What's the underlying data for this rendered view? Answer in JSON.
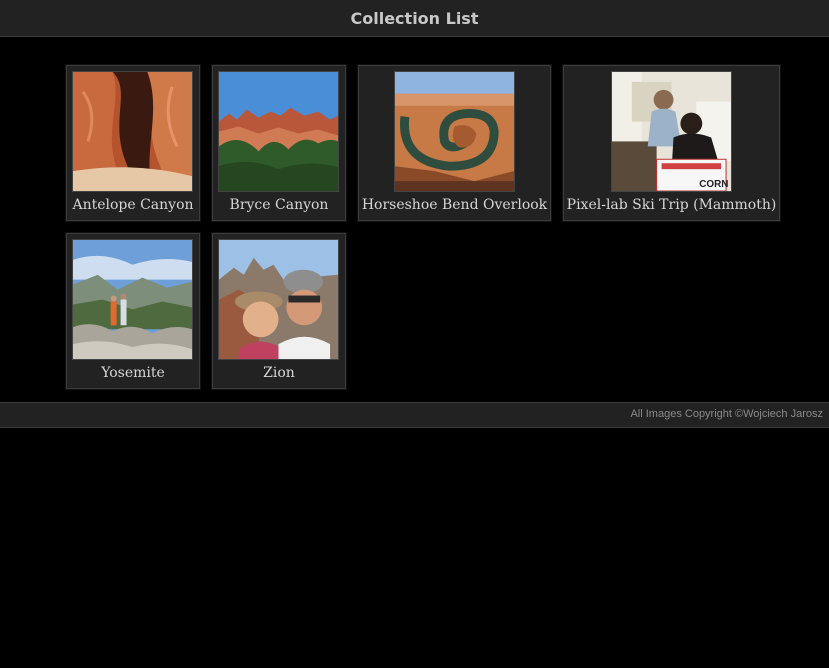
{
  "header": {
    "title": "Collection List"
  },
  "gallery": {
    "items": [
      {
        "caption": "Antelope Canyon",
        "thumbnail": "antelope-canyon-photo"
      },
      {
        "caption": "Bryce Canyon",
        "thumbnail": "bryce-canyon-photo"
      },
      {
        "caption": "Horseshoe Bend Overlook",
        "thumbnail": "horseshoe-bend-photo"
      },
      {
        "caption": "Pixel-lab Ski Trip (Mammoth)",
        "thumbnail": "ski-trip-photo"
      },
      {
        "caption": "Yosemite",
        "thumbnail": "yosemite-photo"
      },
      {
        "caption": "Zion",
        "thumbnail": "zion-photo"
      }
    ]
  },
  "footer": {
    "copyright": "All Images Copyright ©Wojciech Jarosz"
  },
  "colors": {
    "background": "#000000",
    "bar": "#222222",
    "card": "#222222",
    "caption_text": "#d6d6d6",
    "footer_text": "#8a8a8a"
  }
}
